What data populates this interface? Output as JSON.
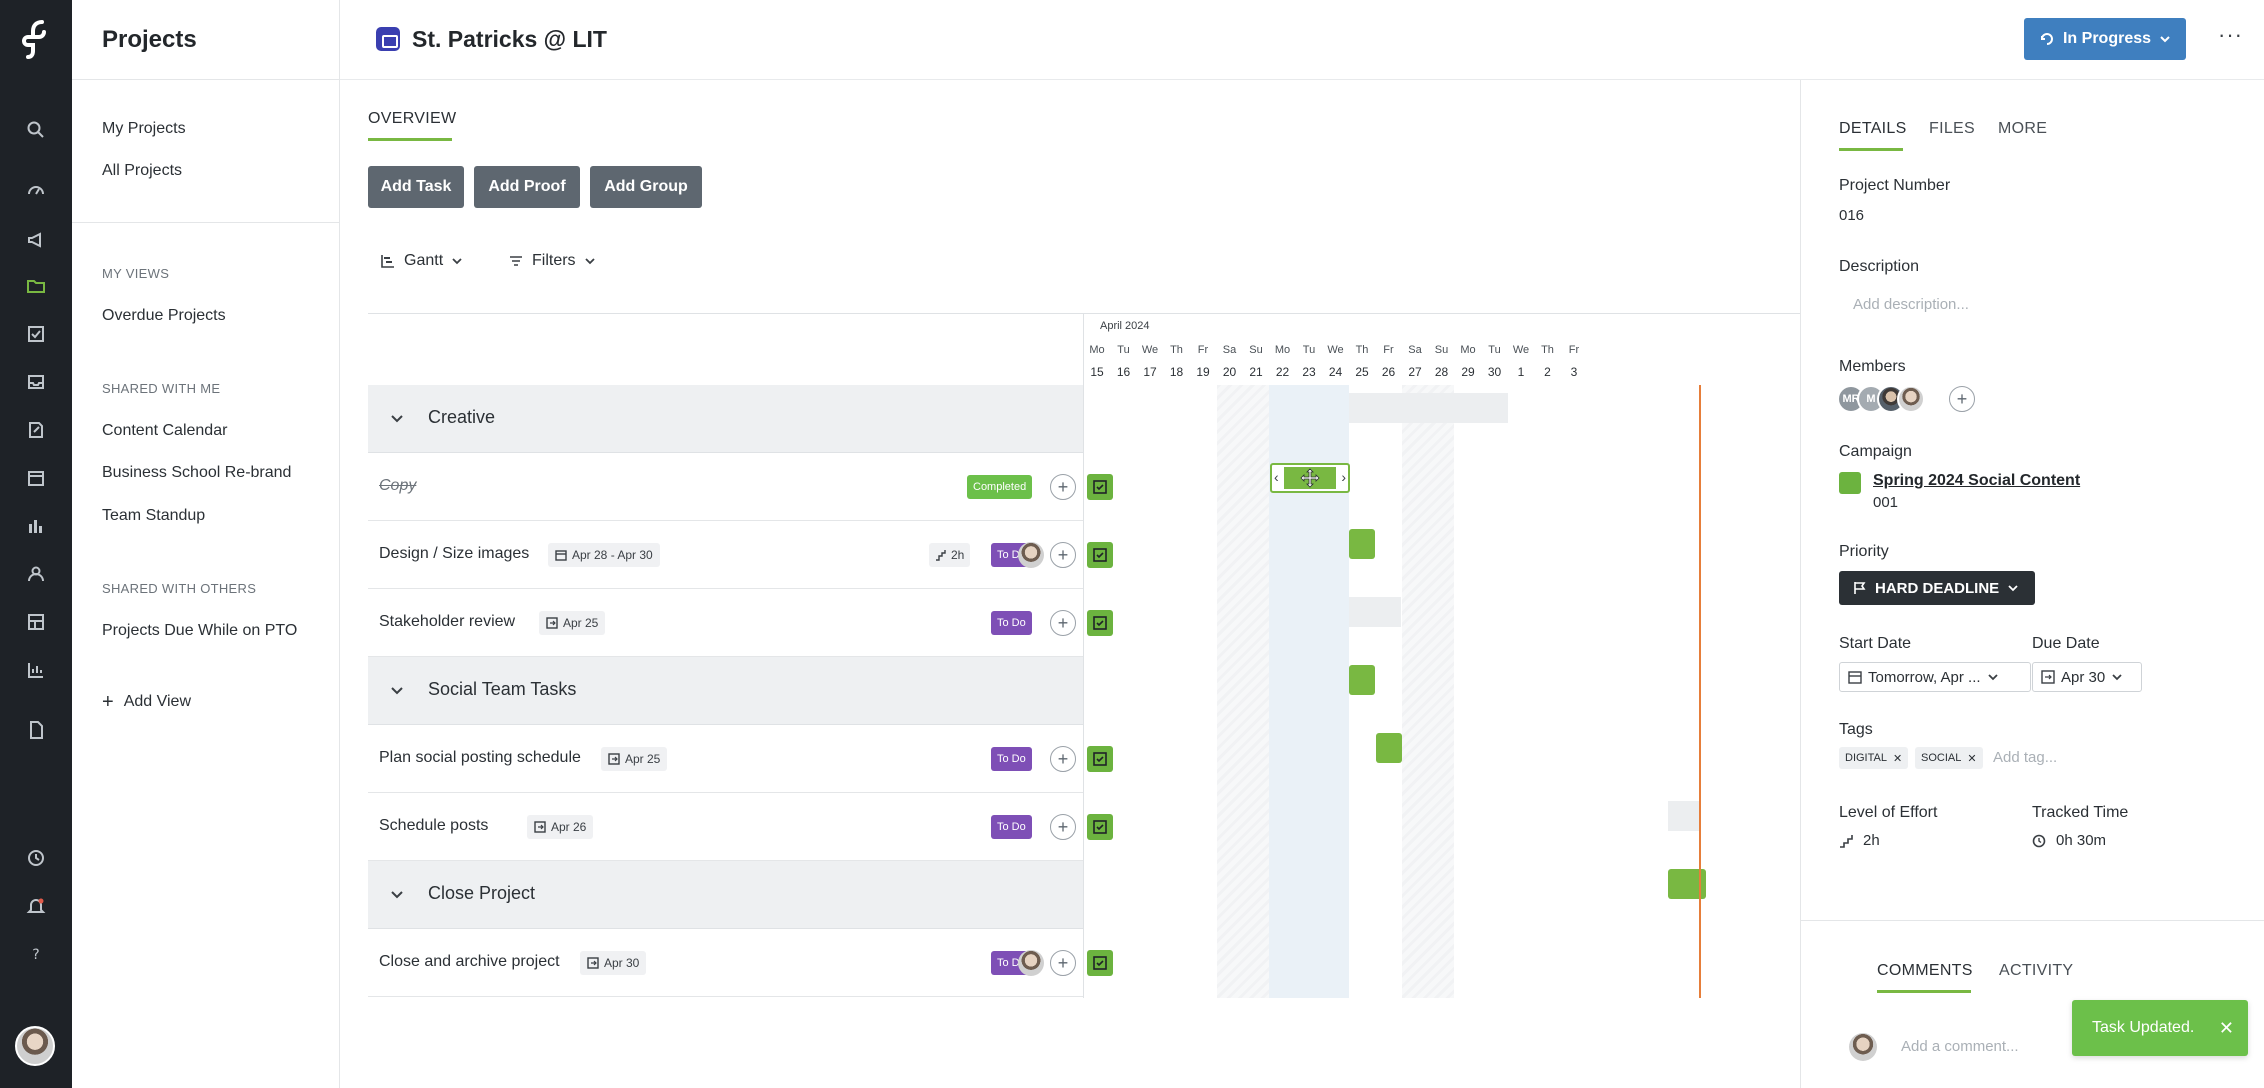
{
  "app": {
    "section_title": "Projects"
  },
  "rail": {
    "icons": [
      "search-icon",
      "dashboard-icon",
      "campaign-icon",
      "folder-icon",
      "tasks-icon",
      "inbox-icon",
      "proof-icon",
      "calendar-icon",
      "reports-icon",
      "people-icon",
      "layout-icon",
      "analytics-icon",
      "document-icon",
      "clock-icon",
      "bell-icon",
      "help-icon"
    ]
  },
  "leftnav": {
    "my_projects": "My Projects",
    "all_projects": "All Projects",
    "my_views_heading": "MY VIEWS",
    "my_views": [
      "Overdue Projects"
    ],
    "shared_with_me_heading": "SHARED WITH ME",
    "shared_with_me": [
      "Content Calendar",
      "Business School Re-brand",
      "Team Standup"
    ],
    "shared_with_others_heading": "SHARED WITH OTHERS",
    "shared_with_others": [
      "Projects Due While on PTO"
    ],
    "add_view": "Add View"
  },
  "header": {
    "project_title": "St. Patricks @ LIT",
    "status": "In Progress",
    "more": "···"
  },
  "main": {
    "tab_overview": "OVERVIEW",
    "buttons": {
      "add_task": "Add Task",
      "add_proof": "Add Proof",
      "add_group": "Add Group"
    },
    "view_mode": "Gantt",
    "filters": "Filters",
    "groups": [
      {
        "name": "Creative",
        "tasks": [
          {
            "name": "Copy",
            "status": "Completed"
          },
          {
            "name": "Design / Size images",
            "date": "Apr 28 - Apr 30",
            "effort": "2h",
            "status": "To Do"
          },
          {
            "name": "Stakeholder review",
            "date": "Apr 25",
            "status": "To Do"
          }
        ]
      },
      {
        "name": "Social Team Tasks",
        "tasks": [
          {
            "name": "Plan social posting schedule",
            "date": "Apr 25",
            "status": "To Do"
          },
          {
            "name": "Schedule posts",
            "date": "Apr 26",
            "status": "To Do"
          }
        ]
      },
      {
        "name": "Close Project",
        "tasks": [
          {
            "name": "Close and archive project",
            "date": "Apr 30",
            "status": "To Do"
          }
        ]
      }
    ]
  },
  "gantt": {
    "month": "April 2024",
    "days": [
      {
        "d": "Mo",
        "n": "15"
      },
      {
        "d": "Tu",
        "n": "16"
      },
      {
        "d": "We",
        "n": "17"
      },
      {
        "d": "Th",
        "n": "18"
      },
      {
        "d": "Fr",
        "n": "19"
      },
      {
        "d": "Sa",
        "n": "20"
      },
      {
        "d": "Su",
        "n": "21"
      },
      {
        "d": "Mo",
        "n": "22"
      },
      {
        "d": "Tu",
        "n": "23"
      },
      {
        "d": "We",
        "n": "24"
      },
      {
        "d": "Th",
        "n": "25"
      },
      {
        "d": "Fr",
        "n": "26"
      },
      {
        "d": "Sa",
        "n": "27"
      },
      {
        "d": "Su",
        "n": "28"
      },
      {
        "d": "Mo",
        "n": "29"
      },
      {
        "d": "Tu",
        "n": "30"
      },
      {
        "d": "We",
        "n": "1"
      },
      {
        "d": "Th",
        "n": "2"
      },
      {
        "d": "Fr",
        "n": "3"
      }
    ]
  },
  "details": {
    "tabs": [
      "DETAILS",
      "FILES",
      "MORE"
    ],
    "project_number_label": "Project Number",
    "project_number": "016",
    "description_label": "Description",
    "description_placeholder": "Add description...",
    "members_label": "Members",
    "members": [
      "MR",
      "M"
    ],
    "campaign_label": "Campaign",
    "campaign_name": "Spring 2024 Social Content",
    "campaign_number": "001",
    "priority_label": "Priority",
    "priority": "HARD DEADLINE",
    "start_date_label": "Start Date",
    "start_date": "Tomorrow, Apr ...",
    "due_date_label": "Due Date",
    "due_date": "Apr 30",
    "tags_label": "Tags",
    "tags": [
      "DIGITAL",
      "SOCIAL"
    ],
    "add_tag_placeholder": "Add tag...",
    "level_of_effort_label": "Level of Effort",
    "level_of_effort": "2h",
    "tracked_time_label": "Tracked Time",
    "tracked_time": "0h 30m",
    "comment_tabs": [
      "COMMENTS",
      "ACTIVITY"
    ],
    "comment_placeholder": "Add a comment..."
  },
  "toast": {
    "message": "Task Updated.",
    "close": "✕"
  },
  "colors": {
    "accent_green": "#79b842",
    "todo_purple": "#7e4fb6",
    "status_blue": "#3f7fbf",
    "today_line": "#e67e3a",
    "rail_bg": "#1e2227"
  }
}
